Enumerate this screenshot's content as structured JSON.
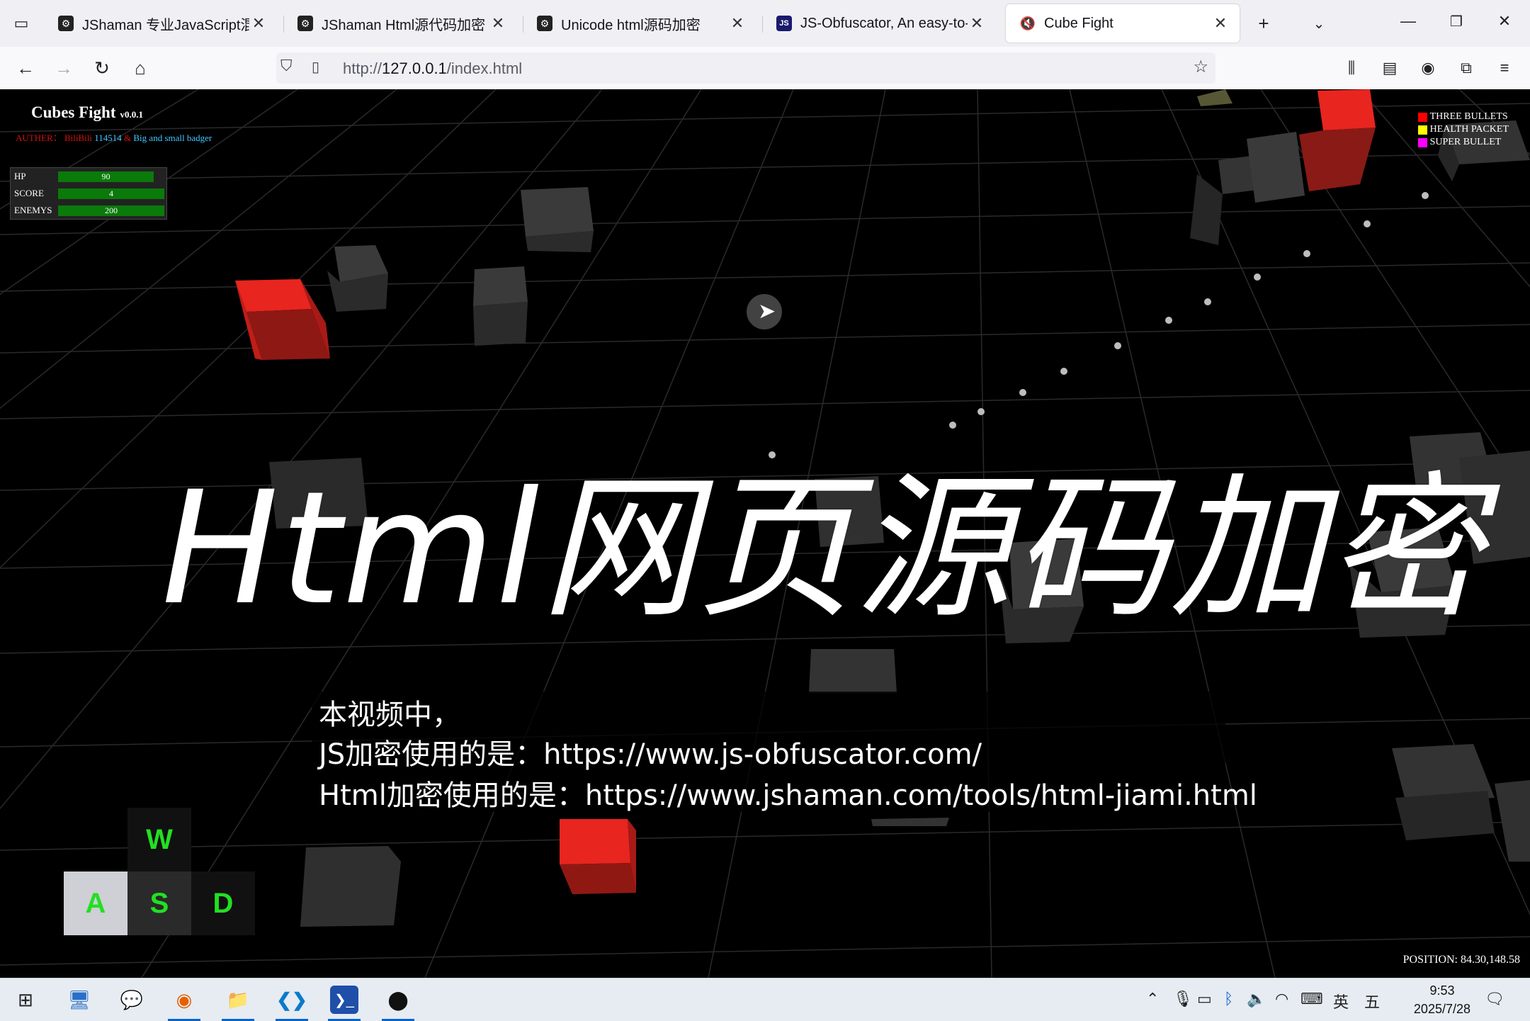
{
  "browser": {
    "tabs": [
      {
        "title": "JShaman 专业JavaScript混淆加",
        "icon": "jshaman-icon"
      },
      {
        "title": "JShaman Html源代码加密 - Ht",
        "icon": "jshaman-icon"
      },
      {
        "title": "Unicode html源码加密",
        "icon": "jshaman-icon"
      },
      {
        "title": "JS-Obfuscator, An easy-to-us",
        "icon": "js-icon"
      },
      {
        "title": "Cube Fight",
        "icon": "muted-speaker-icon"
      }
    ],
    "url_prefix": "http://",
    "url_host": "127.0.0.1",
    "url_path": "/index.html"
  },
  "game": {
    "title": "Cubes Fight",
    "version": "v0.0.1",
    "author_label": "AUTHER：",
    "author_name": "BiliBili",
    "author_id": "114514",
    "author_amp": "&",
    "author_partner": "Big and small badger",
    "stats": [
      {
        "label": "HP",
        "value": "90",
        "fill": 0.9
      },
      {
        "label": "SCORE",
        "value": "4",
        "fill": 1.0
      },
      {
        "label": "ENEMYS",
        "value": "200",
        "fill": 1.0
      }
    ],
    "legend": [
      {
        "label": "THREE BULLETS",
        "color": "#ff0000"
      },
      {
        "label": "HEALTH PACKET",
        "color": "#ffff00"
      },
      {
        "label": "SUPER BULLET",
        "color": "#ff00ff"
      }
    ],
    "keys": {
      "w": "W",
      "a": "A",
      "s": "S",
      "d": "D"
    },
    "position": "POSITION: 84.30,148.58"
  },
  "overlay": {
    "big_title": "Html网页源码加密",
    "lines": [
      "本视频中，",
      "JS加密使用的是：https://www.js-obfuscator.com/",
      "Html加密使用的是：https://www.jshaman.com/tools/html-jiami.html"
    ]
  },
  "taskbar": {
    "ime_lang": "英",
    "ime_mode": "五",
    "time": "9:53",
    "date": "2025/7/28"
  }
}
